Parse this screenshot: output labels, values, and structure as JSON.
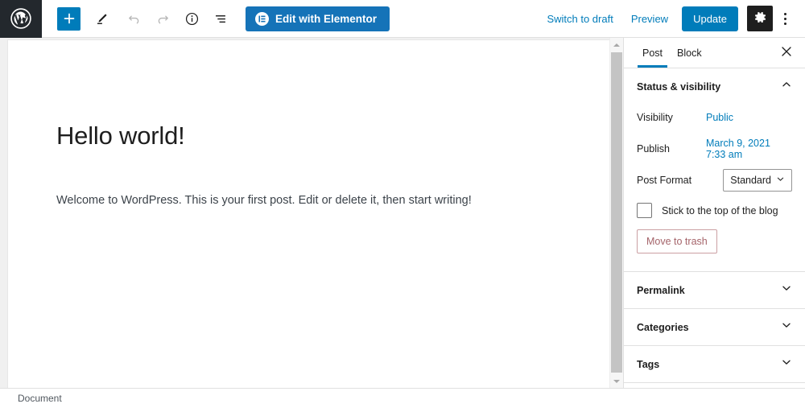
{
  "toolbar": {
    "logo_icon": "wordpress-logo-icon",
    "add_block_label": "+",
    "add_block_name": "add-block-icon",
    "pencil_name": "edit-pencil-icon",
    "undo_name": "undo-icon",
    "redo_name": "redo-icon",
    "info_name": "info-icon",
    "list_view_name": "list-view-icon",
    "elementor_label": "Edit with Elementor",
    "elementor_icon": "elementor-logo-icon",
    "elementor_bg": "#1573b8",
    "switch_to_draft_label": "Switch to draft",
    "preview_label": "Preview",
    "update_label": "Update",
    "update_bg": "#007cba",
    "settings_gear_name": "gear-icon",
    "more_menu_name": "kebab-menu-icon"
  },
  "editor": {
    "post_title": "Hello world!",
    "paragraph": "Welcome to WordPress. This is your first post. Edit or delete it, then start writing!"
  },
  "scrollbar": {
    "up_arrow": "scroll-up-arrow-icon",
    "down_arrow": "scroll-down-arrow-icon"
  },
  "sidebar": {
    "tabs": [
      {
        "label": "Post",
        "active": true
      },
      {
        "label": "Block",
        "active": false
      }
    ],
    "close_icon": "close-icon",
    "accent_color": "#007cba",
    "status_visibility": {
      "title": "Status & visibility",
      "collapse_icon": "chevron-up-icon",
      "expanded": true,
      "visibility_label": "Visibility",
      "visibility_value": "Public",
      "publish_label": "Publish",
      "publish_value": "March 9, 2021 7:33 am",
      "post_format_label": "Post Format",
      "post_format_value": "Standard",
      "post_format_chevron": "chevron-down-icon",
      "sticky_label": "Stick to the top of the blog",
      "sticky_checked": false,
      "trash_label": "Move to trash",
      "trash_color": "#a5646a"
    },
    "sections": [
      {
        "label": "Permalink",
        "icon": "chevron-down-icon",
        "expanded": false
      },
      {
        "label": "Categories",
        "icon": "chevron-down-icon",
        "expanded": false
      },
      {
        "label": "Tags",
        "icon": "chevron-down-icon",
        "expanded": false
      }
    ]
  },
  "statusbar": {
    "document_label": "Document"
  }
}
